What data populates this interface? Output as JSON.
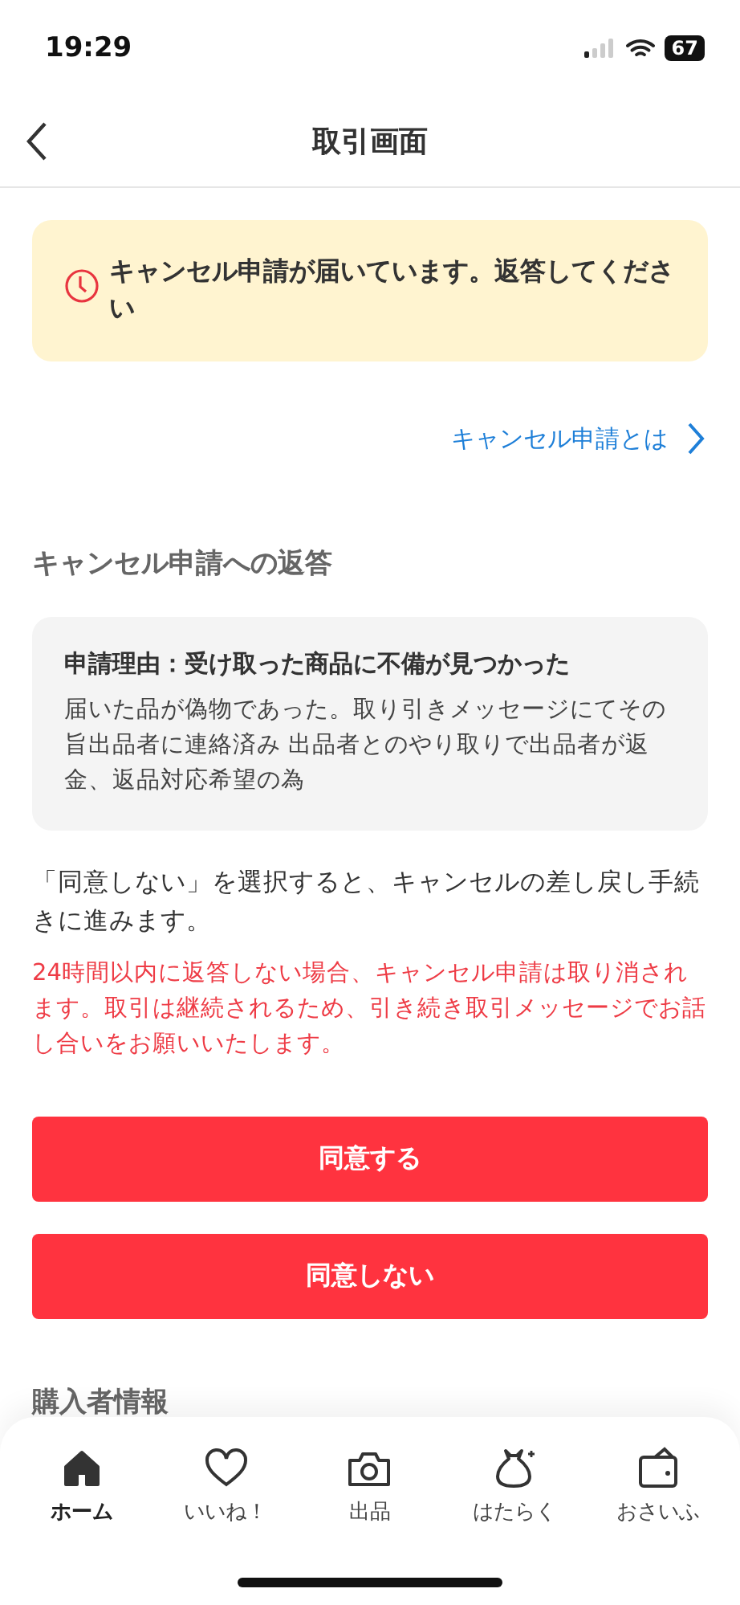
{
  "status_bar": {
    "time": "19:29",
    "battery": "67"
  },
  "header": {
    "title": "取引画面"
  },
  "notice": {
    "text": "キャンセル申請が届いています。返答してください"
  },
  "help_link": {
    "label": "キャンセル申請とは"
  },
  "section_title": "キャンセル申請への返答",
  "reason": {
    "title": "申請理由：受け取った商品に不備が見つかった",
    "body": "届いた品が偽物であった。取り引きメッセージにてその旨出品者に連絡済み 出品者とのやり取りで出品者が返金、返品対応希望の為"
  },
  "info": "「同意しない」を選択すると、キャンセルの差し戻し手続きに進みます。",
  "warning": "24時間以内に返答しない場合、キャンセル申請は取り消されます。取引は継続されるため、引き続き取引メッセージでお話し合いをお願いいたします。",
  "buttons": [
    "同意する",
    "同意しない"
  ],
  "next_section_title": "購入者情報",
  "tabs": [
    {
      "kind": "home",
      "label": "ホーム",
      "selected": true
    },
    {
      "kind": "heart",
      "label": "いいね！",
      "selected": false
    },
    {
      "kind": "camera",
      "label": "出品",
      "selected": false
    },
    {
      "kind": "bag",
      "label": "はたらく",
      "selected": false
    },
    {
      "kind": "wallet",
      "label": "おさいふ",
      "selected": false
    }
  ]
}
